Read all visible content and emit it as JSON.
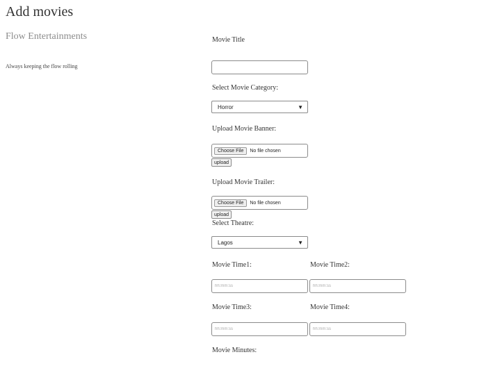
{
  "page_title": "Add movies",
  "sidebar": {
    "brand": "Flow Entertainments",
    "tagline": "Always keeping the flow rolling"
  },
  "form": {
    "movie_title_label": "Movie Title",
    "movie_title_value": "",
    "category_label": "Select Movie Category:",
    "category_selected": "Horror",
    "banner_label": "Upload Movie Banner:",
    "banner_choose": "Choose File",
    "banner_status": "No file chosen",
    "banner_upload": "upload",
    "trailer_label": "Upload Movie Trailer:",
    "trailer_choose": "Choose File",
    "trailer_status": "No file chosen",
    "trailer_upload": "upload",
    "theatre_label": "Select Theatre:",
    "theatre_selected": "Lagos",
    "time1_label": "Movie Time1:",
    "time1_placeholder": "hh:mm:ss",
    "time2_label": "Movie Time2:",
    "time2_placeholder": "hh:mm:ss",
    "time3_label": "Movie Time3:",
    "time3_placeholder": "hh:mm:ss",
    "time4_label": "Movie Time4:",
    "time4_placeholder": "hh:mm:ss",
    "minutes_label": "Movie Minutes:"
  }
}
